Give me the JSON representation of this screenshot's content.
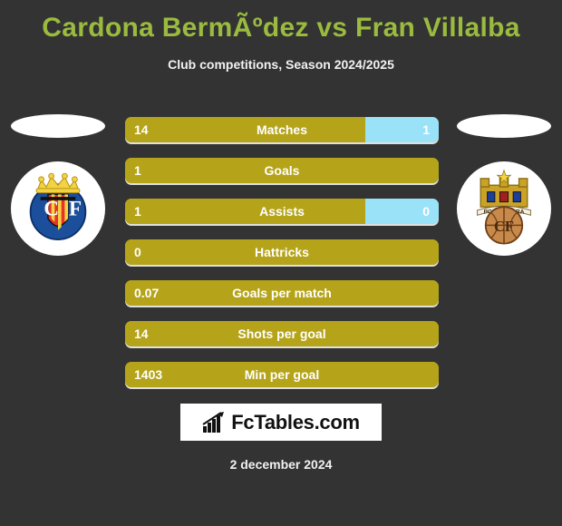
{
  "header": {
    "title": "Cardona BermÃºdez vs Fran Villalba",
    "subtitle": "Club competitions, Season 2024/2025",
    "title_color": "#9bbb3e"
  },
  "teams": {
    "home": {
      "name": "Villarreal CF",
      "badge_icon": "villarreal-cf-badge"
    },
    "away": {
      "name": "Pontevedra CF",
      "badge_icon": "pontevedra-cf-badge"
    }
  },
  "colors": {
    "background": "#333333",
    "left_bar": "#b5a41a",
    "right_bar": "#9ae2f8",
    "text": "#ffffff"
  },
  "chart_data": {
    "type": "bar",
    "title": "Cardona BermÃºdez vs Fran Villalba",
    "subtitle": "Club competitions, Season 2024/2025",
    "orientation": "horizontal-diverging",
    "categories": [
      "Matches",
      "Goals",
      "Assists",
      "Hattricks",
      "Goals per match",
      "Shots per goal",
      "Min per goal"
    ],
    "series": [
      {
        "name": "Cardona BermÃºdez",
        "color": "#b5a41a",
        "values": [
          "14",
          "1",
          "1",
          "0",
          "0.07",
          "14",
          "1403"
        ]
      },
      {
        "name": "Fran Villalba",
        "color": "#9ae2f8",
        "values": [
          "1",
          "",
          "0",
          "",
          "",
          "",
          ""
        ]
      }
    ]
  },
  "stats": [
    {
      "label": "Matches",
      "left": "14",
      "right": "1",
      "left_pct": 76.5,
      "right_pct": 23.5,
      "has_right": true
    },
    {
      "label": "Goals",
      "left": "1",
      "right": "",
      "left_pct": 100,
      "right_pct": 0,
      "has_right": false
    },
    {
      "label": "Assists",
      "left": "1",
      "right": "0",
      "left_pct": 76.5,
      "right_pct": 23.5,
      "has_right": true
    },
    {
      "label": "Hattricks",
      "left": "0",
      "right": "",
      "left_pct": 100,
      "right_pct": 0,
      "has_right": false
    },
    {
      "label": "Goals per match",
      "left": "0.07",
      "right": "",
      "left_pct": 100,
      "right_pct": 0,
      "has_right": false
    },
    {
      "label": "Shots per goal",
      "left": "14",
      "right": "",
      "left_pct": 100,
      "right_pct": 0,
      "has_right": false
    },
    {
      "label": "Min per goal",
      "left": "1403",
      "right": "",
      "left_pct": 100,
      "right_pct": 0,
      "has_right": false
    }
  ],
  "footer": {
    "logo_text": "FcTables.com",
    "logo_icon": "bar-chart-icon",
    "date": "2 december 2024"
  }
}
